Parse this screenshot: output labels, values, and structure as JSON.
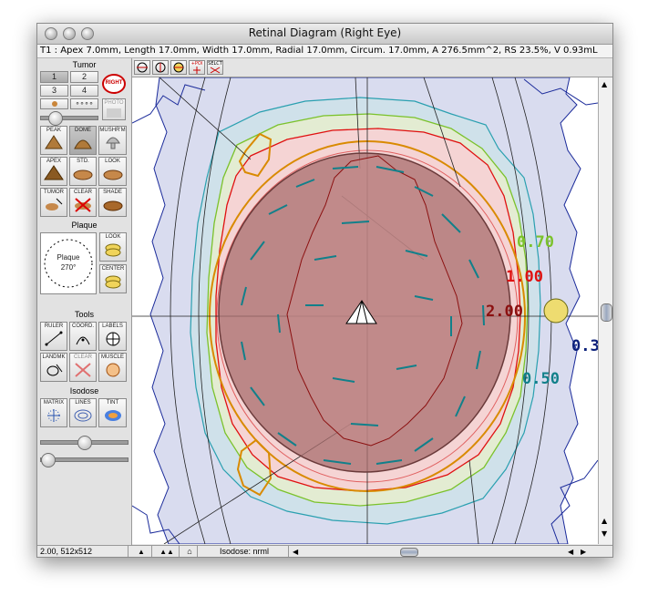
{
  "window": {
    "title": "Retinal Diagram (Right Eye)",
    "info_line": "T1 : Apex 7.0mm, Length 17.0mm, Width 17.0mm, Radial 17.0mm, Circum. 17.0mm, A 276.5mm^2, RS 23.5%, V 0.93mL"
  },
  "palette": {
    "tumor_header": "Tumor",
    "tumor_numbers": [
      "1",
      "2",
      "3",
      "4"
    ],
    "right_badge": "RIGHT",
    "photo_label": "PHOTO",
    "shape_buttons": [
      "PEAK",
      "DOME",
      "MUSHR'M",
      "APEX",
      "STD.",
      "LOOK",
      "TUMOR",
      "CLEAR",
      "SHADE"
    ],
    "plaque_header": "Plaque",
    "plaque_dial_label": "Plaque",
    "plaque_angle": "270°",
    "plaque_buttons": [
      "LOOK",
      "CENTER"
    ],
    "tools_header": "Tools",
    "tool_buttons": [
      "RULER",
      "COORD.",
      "LABELS",
      "LANDMK",
      "CLEAR",
      "MUSCLE"
    ],
    "isodose_header": "Isodose",
    "isodose_buttons": [
      "MATRIX",
      "LINES",
      "TINT"
    ]
  },
  "toolbar": {
    "buttons": [
      "+POI",
      "SELCT"
    ]
  },
  "isodose_labels": {
    "l070": "0.70",
    "l100": "1.00",
    "l200": "2.00",
    "l030": "0.3",
    "l050": "0.50"
  },
  "colors": {
    "iso_070": "#7bc22b",
    "iso_100": "#e01010",
    "iso_200": "#8b1010",
    "iso_030": "#0a1f7a",
    "iso_050": "#11808a",
    "tumor_fill": "#a86e6e",
    "accent_orange": "#d98a00"
  },
  "status": {
    "zoom_info": "2.00, 512x512",
    "isodose_mode": "Isodose: nrml"
  }
}
